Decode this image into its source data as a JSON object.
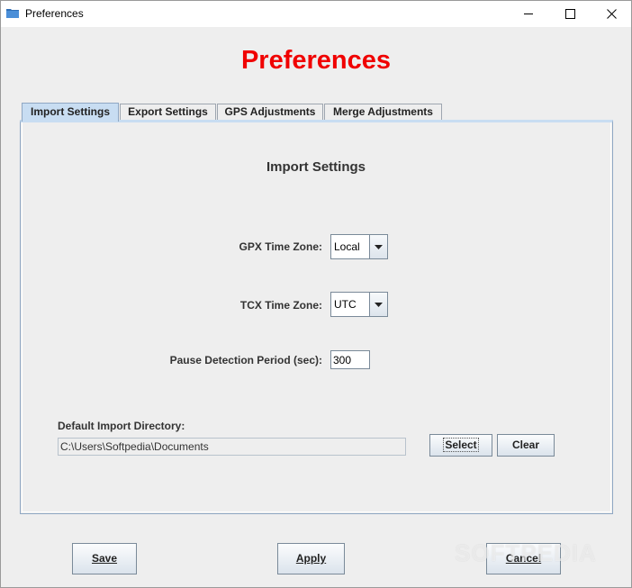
{
  "window": {
    "title": "Preferences",
    "icon": "folder-icon"
  },
  "heading": "Preferences",
  "tabs": [
    {
      "label": "Import Settings",
      "active": true
    },
    {
      "label": "Export Settings",
      "active": false
    },
    {
      "label": "GPS Adjustments",
      "active": false
    },
    {
      "label": "Merge Adjustments",
      "active": false
    }
  ],
  "import_settings": {
    "section_title": "Import Settings",
    "gpx_time_zone": {
      "label": "GPX Time Zone:",
      "value": "Local"
    },
    "tcx_time_zone": {
      "label": "TCX Time Zone:",
      "value": "UTC"
    },
    "pause_detection": {
      "label": "Pause Detection Period (sec):",
      "value": "300"
    },
    "default_directory": {
      "label": "Default Import Directory:",
      "value": "C:\\Users\\Softpedia\\Documents"
    },
    "select_label": "Select",
    "clear_label": "Clear"
  },
  "footer": {
    "save_label": "Save",
    "apply_label": "Apply",
    "cancel_label": "Cancel"
  },
  "watermark": "SOFTPEDIA",
  "colors": {
    "heading": "#f00000",
    "active_tab": "#c8ddf2",
    "background": "#eeeeee"
  }
}
